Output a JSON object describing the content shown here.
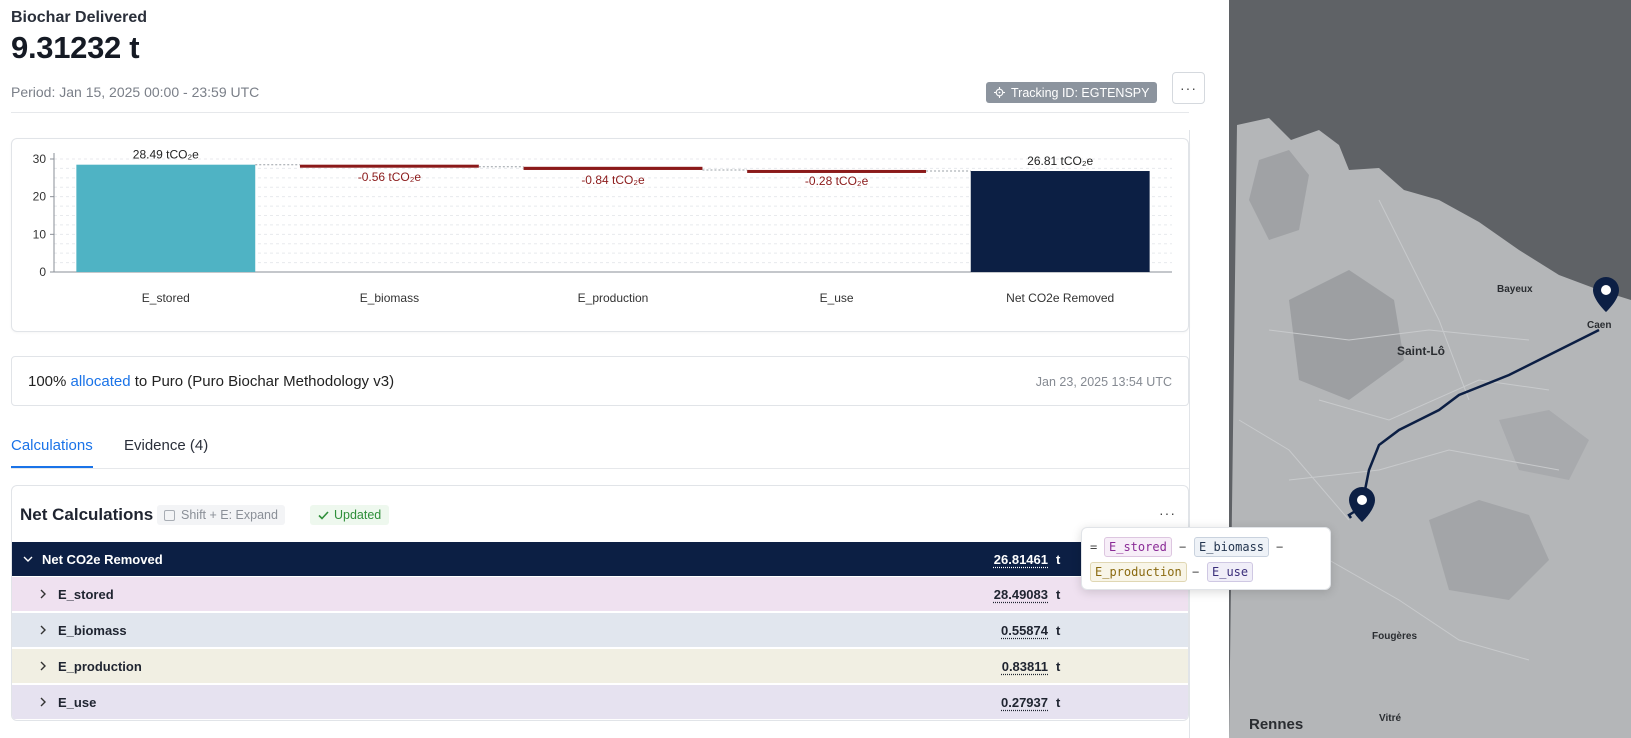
{
  "header": {
    "label": "Biochar Delivered",
    "value": "9.31232 t",
    "period": "Period: Jan 15, 2025 00:00 - 23:59 UTC",
    "tracking": "Tracking ID: EGTENSPY",
    "more_label": "···"
  },
  "chart_data": {
    "type": "bar",
    "subtype": "waterfall",
    "categories": [
      "E_stored",
      "E_biomass",
      "E_production",
      "E_use",
      "Net CO2e Removed"
    ],
    "values": [
      28.49,
      -0.56,
      -0.84,
      -0.28,
      26.81
    ],
    "data_labels": [
      "28.49 tCO₂e",
      "-0.56 tCO₂e",
      "-0.84 tCO₂e",
      "-0.28 tCO₂e",
      "26.81 tCO₂e"
    ],
    "yticks": [
      "0",
      "10",
      "20",
      "30"
    ],
    "ylim": [
      0,
      30
    ],
    "grid": true,
    "colors": {
      "stored": "#4fb3c4",
      "negative": "#8b1a1a",
      "net": "#0c1f44"
    }
  },
  "allocation": {
    "percent": "100%",
    "link": "allocated",
    "text": "to Puro (Puro Biochar Methodology v3)",
    "date": "Jan 23, 2025 13:54 UTC"
  },
  "tabs": [
    {
      "label": "Calculations",
      "active": true
    },
    {
      "label": "Evidence (4)",
      "active": false
    }
  ],
  "calc": {
    "title": "Net Calculations",
    "shortcut": "Shift + E: Expand",
    "status": "Updated",
    "more_label": "···",
    "rows": [
      {
        "label": "Net CO2e Removed",
        "value": "26.81461",
        "unit": "t",
        "bg": "#0c1f44"
      },
      {
        "label": "E_stored",
        "value": "28.49083",
        "unit": "t",
        "bg": "#efe1f0"
      },
      {
        "label": "E_biomass",
        "value": "0.55874",
        "unit": "t",
        "bg": "#e1e6ee"
      },
      {
        "label": "E_production",
        "value": "0.83811",
        "unit": "t",
        "bg": "#f1efe3"
      },
      {
        "label": "E_use",
        "value": "0.27937",
        "unit": "t",
        "bg": "#e6e2f0"
      }
    ]
  },
  "tooltip": {
    "eq": "=",
    "minus": "−",
    "tokens": [
      "E_stored",
      "E_biomass",
      "E_production",
      "E_use"
    ]
  },
  "map": {
    "labels": [
      "Bayeux",
      "Caen",
      "Saint-Lô",
      "Fougères",
      "Rennes",
      "Vitré"
    ]
  }
}
